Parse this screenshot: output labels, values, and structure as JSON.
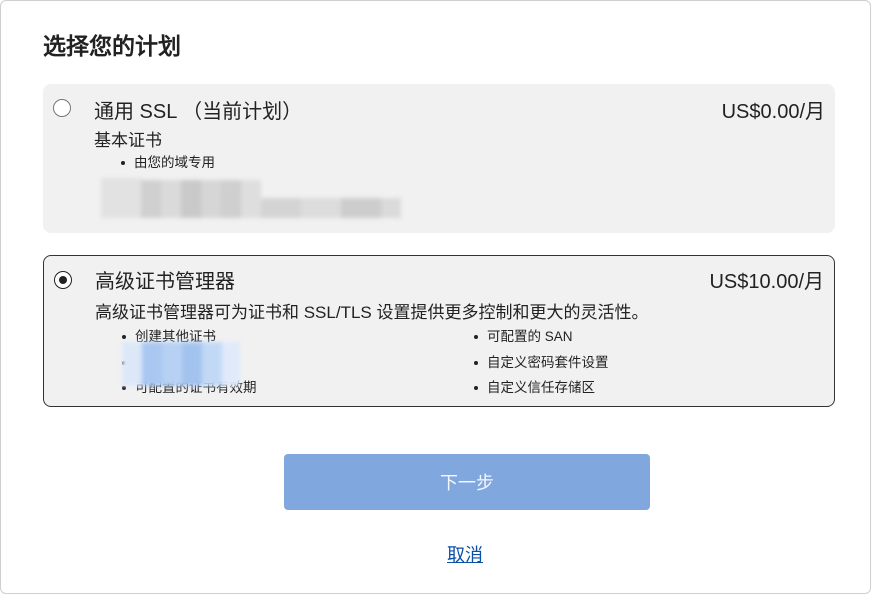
{
  "title": "选择您的计划",
  "plans": [
    {
      "name": "通用 SSL （当前计划）",
      "price": "US$0.00/月",
      "description": "基本证书",
      "selected": false,
      "features": [
        "由您的域专用"
      ]
    },
    {
      "name": "高级证书管理器",
      "price": "US$10.00/月",
      "description": "高级证书管理器可为证书和 SSL/TLS 设置提供更多控制和更大的灵活性。",
      "selected": true,
      "features_left": [
        "创建其他证书",
        "",
        "可配置的证书有效期"
      ],
      "features_right": [
        "可配置的 SAN",
        "自定义密码套件设置",
        "自定义信任存储区"
      ]
    }
  ],
  "buttons": {
    "next": "下一步",
    "cancel": "取消"
  },
  "colors": {
    "next_button_bg": "#80a7de",
    "link": "#0a4fa8"
  }
}
